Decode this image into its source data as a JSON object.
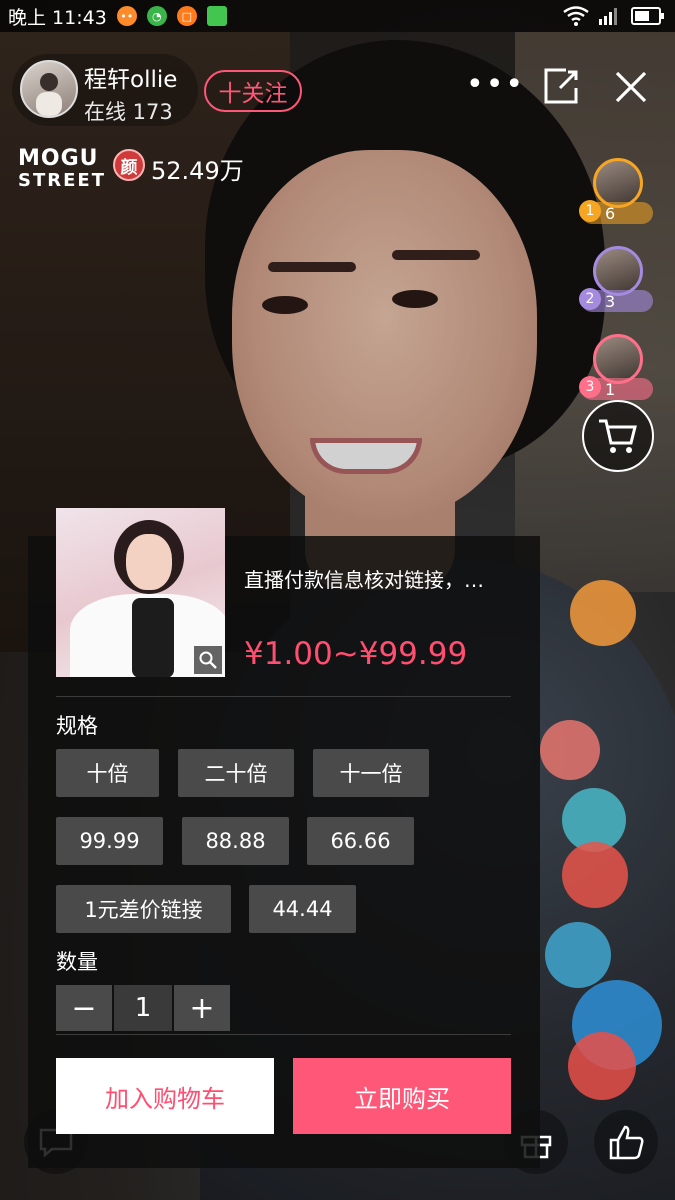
{
  "status_bar": {
    "time": "晚上 11:43",
    "battery_label": "battery"
  },
  "host": {
    "name": "程轩ollie",
    "online_label": "在线 173",
    "follow_label": "十关注"
  },
  "brand": {
    "line1": "MOGU",
    "line2": "STREET"
  },
  "coins": {
    "icon_char": "颜",
    "value": "52.49万"
  },
  "rank_list": [
    {
      "rank": "1",
      "count": "6",
      "color": "#f6a623"
    },
    {
      "rank": "2",
      "count": "3",
      "color": "#a58be0"
    },
    {
      "rank": "3",
      "count": "1",
      "color": "#ff6f8a"
    }
  ],
  "product": {
    "title": "直播付款信息核对链接，…",
    "price": "¥1.00~¥99.99"
  },
  "spec": {
    "label": "规格",
    "options": [
      "十倍",
      "二十倍",
      "十一倍",
      "99.99",
      "88.88",
      "66.66",
      "1元差价链接",
      "44.44"
    ]
  },
  "quantity": {
    "label": "数量",
    "value": "1",
    "minus": "−",
    "plus": "+"
  },
  "actions": {
    "add_to_cart": "加入购物车",
    "buy_now": "立即购买"
  },
  "colors": {
    "accent": "#ff5777",
    "price": "#ff4e70",
    "option_bg": "#4a4a4a"
  }
}
